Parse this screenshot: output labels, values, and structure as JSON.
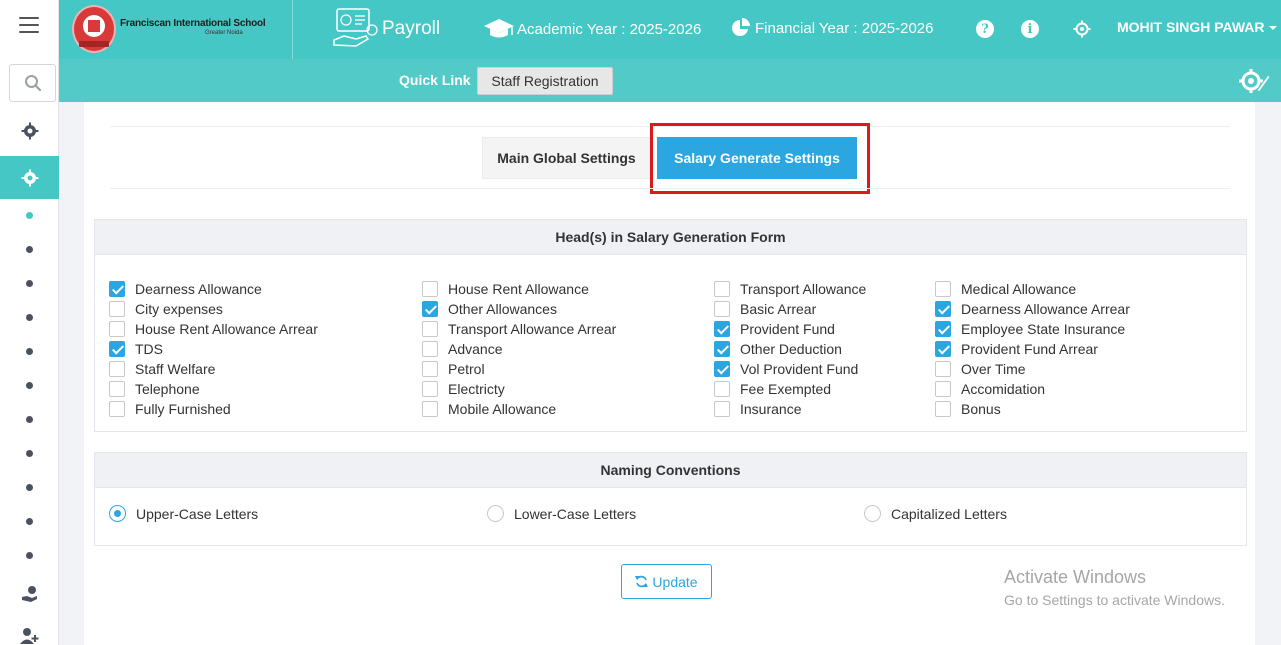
{
  "header": {
    "school_name": "Franciscan International School",
    "school_location": "Greater Noida",
    "module": "Payroll",
    "academic_year": "Academic Year : 2025-2026",
    "financial_year": "Financial Year : 2025-2026",
    "help_glyph": "?",
    "info_glyph": "i",
    "user": "MOHIT SINGH PAWAR"
  },
  "quicklink": {
    "label": "Quick Link",
    "button": "Staff Registration"
  },
  "tabs": {
    "main": "Main Global Settings",
    "salary": "Salary Generate Settings",
    "active": "salary"
  },
  "heads_section": {
    "title": "Head(s) in Salary Generation Form",
    "columns": [
      [
        {
          "label": "Dearness Allowance",
          "checked": true
        },
        {
          "label": "City expenses",
          "checked": false
        },
        {
          "label": "House Rent Allowance Arrear",
          "checked": false
        },
        {
          "label": "TDS",
          "checked": true
        },
        {
          "label": "Staff Welfare",
          "checked": false
        },
        {
          "label": "Telephone",
          "checked": false
        },
        {
          "label": "Fully Furnished",
          "checked": false
        }
      ],
      [
        {
          "label": "House Rent Allowance",
          "checked": false
        },
        {
          "label": "Other Allowances",
          "checked": true
        },
        {
          "label": "Transport Allowance Arrear",
          "checked": false
        },
        {
          "label": "Advance",
          "checked": false
        },
        {
          "label": "Petrol",
          "checked": false
        },
        {
          "label": "Electricty",
          "checked": false
        },
        {
          "label": "Mobile Allowance",
          "checked": false
        }
      ],
      [
        {
          "label": "Transport Allowance",
          "checked": false
        },
        {
          "label": "Basic Arrear",
          "checked": false
        },
        {
          "label": "Provident Fund",
          "checked": true
        },
        {
          "label": "Other Deduction",
          "checked": true
        },
        {
          "label": "Vol Provident Fund",
          "checked": true
        },
        {
          "label": "Fee Exempted",
          "checked": false
        },
        {
          "label": "Insurance",
          "checked": false
        }
      ],
      [
        {
          "label": "Medical Allowance",
          "checked": false
        },
        {
          "label": "Dearness Allowance Arrear",
          "checked": true
        },
        {
          "label": "Employee State Insurance",
          "checked": true
        },
        {
          "label": "Provident Fund Arrear",
          "checked": true
        },
        {
          "label": "Over Time",
          "checked": false
        },
        {
          "label": "Accomidation",
          "checked": false
        },
        {
          "label": "Bonus",
          "checked": false
        }
      ]
    ]
  },
  "naming_section": {
    "title": "Naming Conventions",
    "options": [
      {
        "label": "Upper-Case Letters",
        "selected": true
      },
      {
        "label": "Lower-Case Letters",
        "selected": false
      },
      {
        "label": "Capitalized Letters",
        "selected": false
      }
    ]
  },
  "update_button": "Update",
  "watermark": {
    "title": "Activate Windows",
    "subtitle": "Go to Settings to activate Windows."
  },
  "colors": {
    "accent_teal": "#45c8c5",
    "primary_blue": "#2ba6e0",
    "highlight_red": "#e1171e"
  },
  "icons": {
    "sidebar": [
      "menu-icon",
      "search-icon",
      "gear-cog-icon",
      "settings-gear-icon",
      "payroll-hand-icon",
      "add-user-icon"
    ],
    "header": [
      "payroll-icon",
      "graduation-cap-icon",
      "pie-chart-icon",
      "help-icon",
      "info-icon",
      "settings-icon",
      "chevron-down-icon"
    ],
    "quickbar": [
      "settings-edit-icon"
    ],
    "button": [
      "refresh-icon"
    ]
  }
}
